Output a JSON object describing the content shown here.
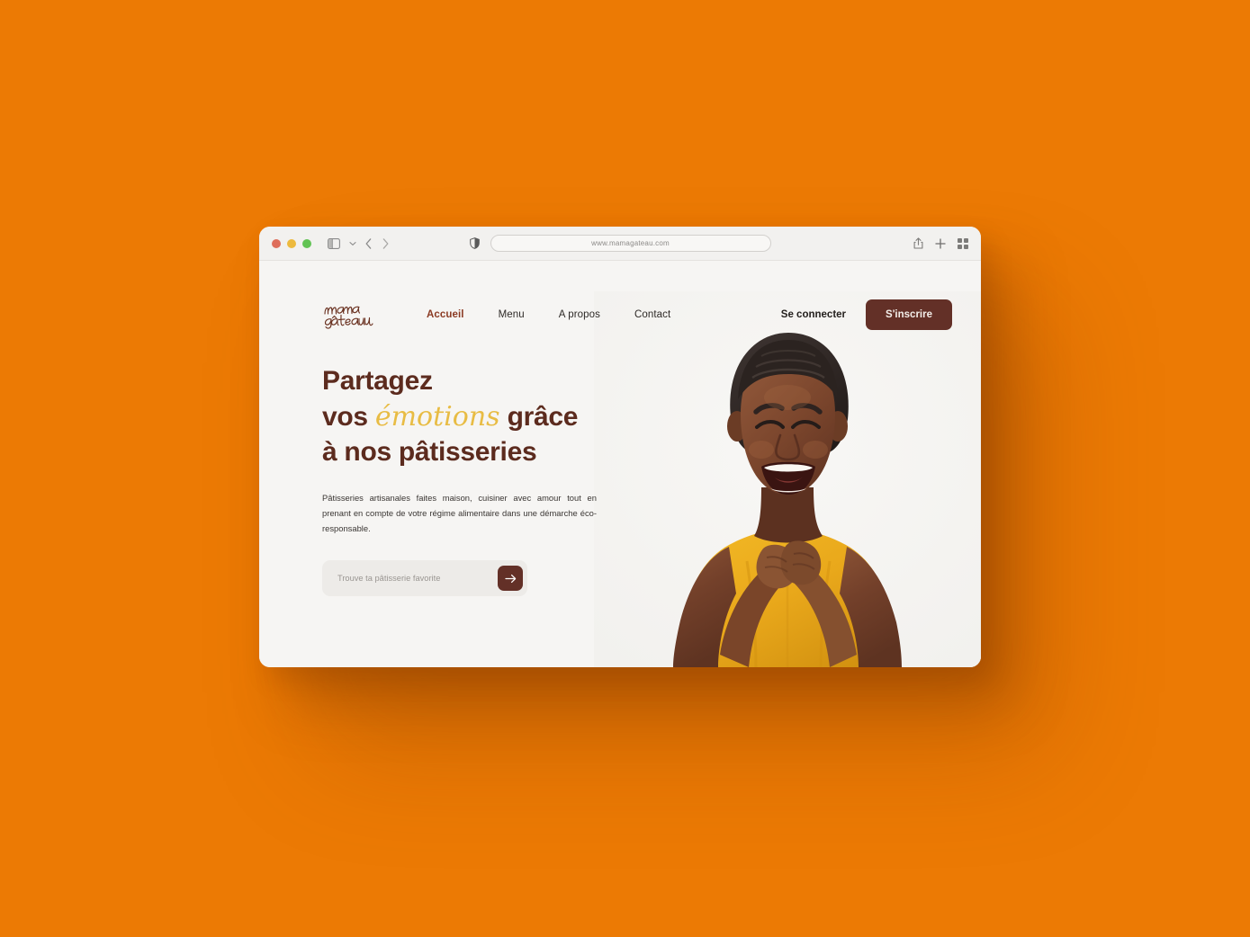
{
  "theme": {
    "page_background": "#EC7A04",
    "site_background": "#F6F5F3",
    "brand_brown": "#633027",
    "headline_brown": "#5C2B1E",
    "accent_yellow": "#E8BC44",
    "active_link": "#8B3A23",
    "shirt_yellow": "#E9A81B"
  },
  "browser": {
    "url": "www.mamagateau.com",
    "traffic_lights": [
      "close",
      "minimize",
      "zoom"
    ],
    "icons": {
      "sidebar": "sidebar-icon",
      "sidebar_chevron": "chevron-down-icon",
      "back": "back-arrow-icon",
      "forward": "forward-arrow-icon",
      "shield": "shield-icon",
      "share": "share-icon",
      "new_tab": "plus-icon",
      "tab_overview": "grid-icon"
    }
  },
  "site": {
    "logo": {
      "line1": "mama",
      "line2": "gâteau",
      "alt": "mama gâteau"
    },
    "nav": [
      {
        "label": "Accueil",
        "active": true
      },
      {
        "label": "Menu",
        "active": false
      },
      {
        "label": "A propos",
        "active": false
      },
      {
        "label": "Contact",
        "active": false
      }
    ],
    "auth": {
      "login_label": "Se connecter",
      "signup_label": "S'inscrire"
    },
    "hero": {
      "headline_line1": "Partagez",
      "headline_line2_pre": "vos ",
      "headline_line2_accent": "émotions",
      "headline_line2_post": " grâce",
      "headline_line3": "à nos pâtisseries",
      "subcopy": "Pâtisseries artisanales faites maison, cuisiner avec amour tout en prenant en compte de votre régime alimentaire dans une démarche éco-responsable.",
      "search_placeholder": "Trouve ta pâtisserie favorite",
      "search_value": "",
      "search_submit_icon": "arrow-right-icon",
      "photo_alt": "Femme souriante en t-shirt jaune, mains jointes"
    }
  }
}
